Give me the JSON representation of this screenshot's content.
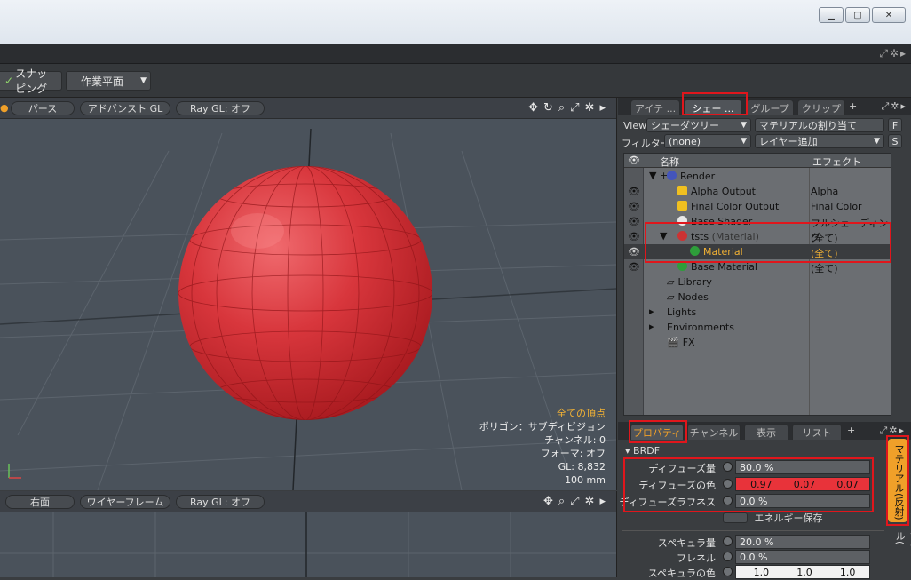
{
  "toolbar": {
    "snapping": "スナッピング",
    "workplane": "作業平面"
  },
  "viewport_top": {
    "pills": [
      "パース",
      "アドバンスト GL",
      "Ray GL: オフ"
    ],
    "info": [
      "全ての頂点",
      "ポリゴン：サブディビジョン",
      "チャンネル: 0",
      "フォーマ: オフ",
      "GL: 8,832",
      "100 mm"
    ]
  },
  "viewport_bottom": {
    "pills": [
      "右面",
      "ワイヤーフレーム",
      "Ray GL: オフ"
    ]
  },
  "shader_panel": {
    "tabs": [
      "アイテ ...",
      "シェー ...",
      "グループ",
      "クリップ"
    ],
    "view_label": "View",
    "view_value": "シェーダツリー",
    "assign_button": "マテリアルの割り当て",
    "f_button": "F",
    "filter_label": "フィルター",
    "filter_value": "(none)",
    "add_layer": "レイヤー追加",
    "s_button": "S",
    "col_name": "名称",
    "col_effect": "エフェクト",
    "rows": [
      {
        "name": "Render",
        "effect": "",
        "swatch": "#4455bb"
      },
      {
        "name": "Alpha Output",
        "effect": "Alpha",
        "swatch": "#f0c020"
      },
      {
        "name": "Final Color Output",
        "effect": "Final Color",
        "swatch": "#f0c020"
      },
      {
        "name": "Base Shader",
        "effect": "フルシェーディング",
        "swatch": "#e8e8e8"
      },
      {
        "name": "tsts",
        "name_suffix": "(Material)",
        "effect": "(全て)",
        "swatch": "#c33"
      },
      {
        "name": "Material",
        "effect": "(全て)",
        "swatch": "#2e9e3a"
      },
      {
        "name": "Base Material",
        "effect": "(全て)",
        "swatch": "#2e9e3a"
      },
      {
        "name": "Library",
        "effect": ""
      },
      {
        "name": "Nodes",
        "effect": ""
      },
      {
        "name": "Lights",
        "effect": ""
      },
      {
        "name": "Environments",
        "effect": ""
      },
      {
        "name": "FX",
        "effect": ""
      }
    ]
  },
  "properties": {
    "tabs": [
      "プロパティ",
      "チャンネル",
      "表示",
      "リスト"
    ],
    "section": "BRDF",
    "diffuse_amount_label": "ディフューズ量",
    "diffuse_amount": "80.0 %",
    "diffuse_color_label": "ディフューズの色",
    "diffuse_color": [
      "0.97",
      "0.07",
      "0.07"
    ],
    "diffuse_roughness_label": "ディフューズラフネス",
    "diffuse_roughness": "0.0 %",
    "energy_label": "エネルギー保存",
    "specular_amount_label": "スペキュラ量",
    "specular_amount": "20.0 %",
    "fresnel_label": "フレネル",
    "fresnel": "0.0 %",
    "specular_color_label": "スペキュラの色",
    "specular_color": [
      "1.0",
      "1.0",
      "1.0"
    ],
    "side_tab": "マテリアル(反射)",
    "side_tab2": "マテリアル(",
    "colors": {
      "diffuse_bg": "#e8333a",
      "accent": "#f0a029",
      "highlight": "#e0161c"
    }
  }
}
